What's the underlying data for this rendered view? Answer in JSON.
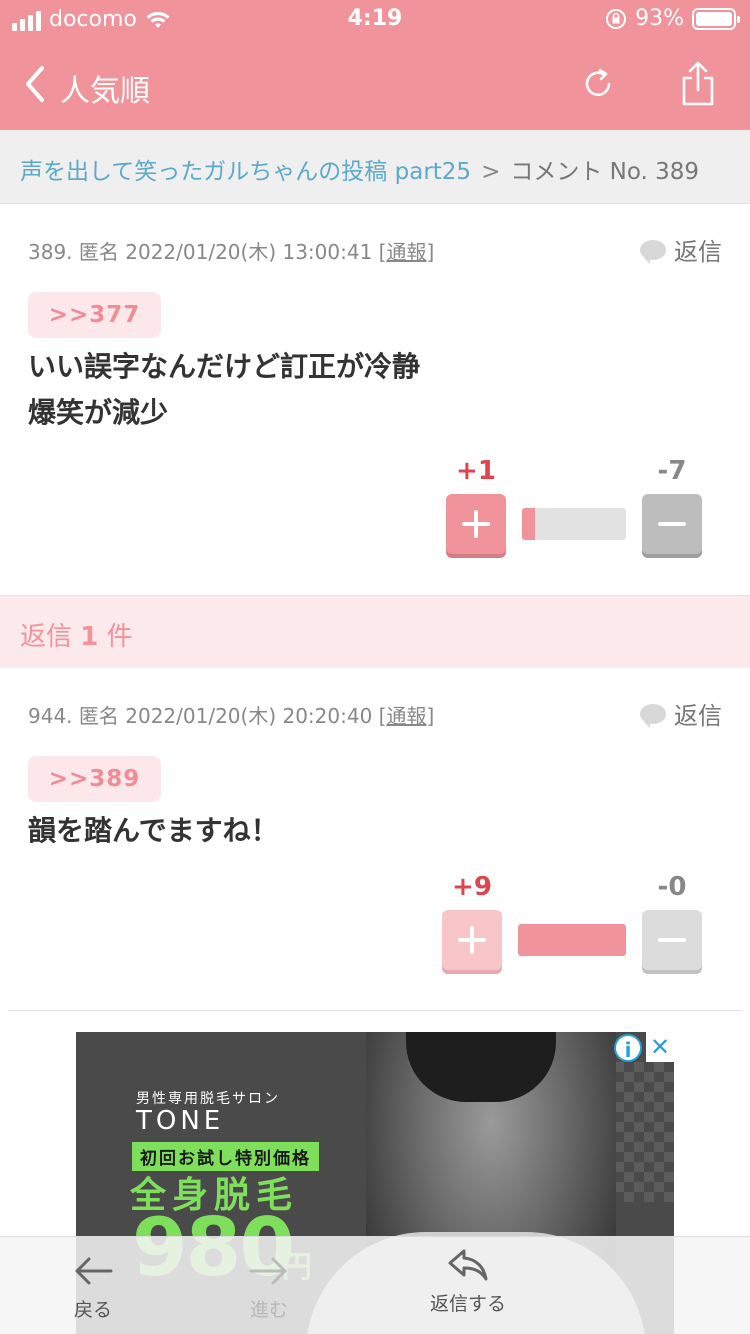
{
  "status_bar": {
    "carrier": "docomo",
    "time": "4:19",
    "battery": "93%"
  },
  "nav": {
    "title": "人気順"
  },
  "breadcrumb": {
    "thread": "声を出して笑ったガルちゃんの投稿 part25",
    "separator": ">",
    "current": "コメント No. 389"
  },
  "comments": [
    {
      "number": "389.",
      "author": "匿名",
      "date": "2022/01/20(木) 13:00:41",
      "report": "通報",
      "reply_label": "返信",
      "anchor": ">>377",
      "lines": [
        "いい誤字なんだけど訂正が冷静",
        "爆笑が減少"
      ],
      "plus": "+1",
      "minus": "-7",
      "plus_ratio": 0.125
    },
    {
      "number": "944.",
      "author": "匿名",
      "date": "2022/01/20(木) 20:20:40",
      "report": "通報",
      "reply_label": "返信",
      "anchor": ">>389",
      "lines": [
        "韻を踏んでますね！"
      ],
      "plus": "+9",
      "minus": "-0",
      "plus_ratio": 1.0
    }
  ],
  "reply_count": {
    "prefix": "返信",
    "count": "1",
    "suffix": "件"
  },
  "ad": {
    "salon": "男性専用脱毛サロン",
    "brand": "TONE",
    "offer": "初回お試し特別価格",
    "headline": "全身脱毛",
    "price": "980",
    "yen": "円",
    "info": "i",
    "close": "✕"
  },
  "toolbar": {
    "back": "戻る",
    "forward": "進む",
    "reply": "返信する"
  },
  "colors": {
    "accent": "#f0939a",
    "link": "#5da9c9",
    "plus": "#e0454f"
  }
}
